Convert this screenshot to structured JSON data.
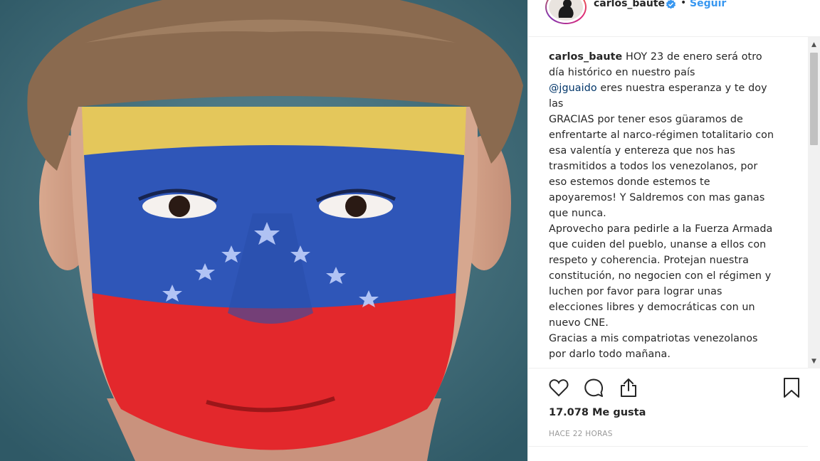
{
  "post": {
    "username": "carlos_baute",
    "separator": "•",
    "follow_label": "Seguir"
  },
  "caption": {
    "username": "carlos_baute",
    "line1": " HOY 23 de enero será otro\ndía histórico en nuestro país\n",
    "mention": "@jguaido",
    "line2": " eres nuestra esperanza y te doy\nlas\nGRACIAS por tener esos güaramos de\nenfrentarte al narco-régimen totalitario con\nesa valentía y entereza que nos has\ntrasmitidos a todos los venezolanos, por\neso estemos donde estemos te\napoyaremos! Y Saldremos con mas ganas\nque nunca.\nAprovecho para pedirle a la Fuerza Armada\nque cuiden del pueblo, unanse a ellos con\nrespeto y coherencia.  Protejan nuestra\nconstitución, no negocien con el régimen y\nluchen por favor para lograr unas\nelecciones libres y democráticas con un\nnuevo CNE.\nGracias a mis compatriotas venezolanos\npor darlo todo mañana."
  },
  "stats": {
    "likes": "17.078 Me gusta",
    "time": "HACE 22 HORAS"
  },
  "icons": {
    "like": "heart-icon",
    "comment": "comment-icon",
    "share": "share-icon",
    "save": "bookmark-icon",
    "verified": "verified-badge-icon"
  },
  "colors": {
    "link": "#3897f0",
    "mention": "#003569",
    "text": "#262626",
    "muted": "#999999"
  }
}
